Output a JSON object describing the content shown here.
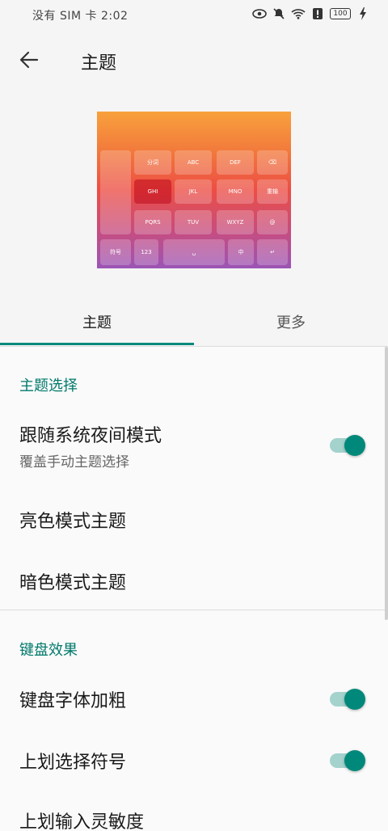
{
  "status_bar": {
    "text": "没有 SIM 卡 2:02",
    "battery": "100",
    "icons": [
      "eye-icon",
      "mute-icon",
      "wifi-icon",
      "alert-icon",
      "battery-icon",
      "charging-icon"
    ]
  },
  "header": {
    "title": "主题",
    "back_icon": "back-arrow-icon"
  },
  "keyboard_preview": {
    "rows": [
      [
        "分词",
        "ABC",
        "DEF",
        "⌫"
      ],
      [
        "GHI",
        "JKL",
        "MNO",
        "重输"
      ],
      [
        "PQRS",
        "TUV",
        "WXYZ",
        "@"
      ]
    ],
    "bottom": [
      "符号",
      "123",
      "␣",
      "中",
      "↵"
    ]
  },
  "tabs": [
    {
      "label": "主题",
      "active": true
    },
    {
      "label": "更多",
      "active": false
    }
  ],
  "sections": {
    "theme": {
      "header": "主题选择",
      "follow_system": {
        "title": "跟随系统夜间模式",
        "subtitle": "覆盖手动主题选择",
        "enabled": true
      },
      "light_theme": {
        "title": "亮色模式主题"
      },
      "dark_theme": {
        "title": "暗色模式主题"
      }
    },
    "effects": {
      "header": "键盘效果",
      "bold_font": {
        "title": "键盘字体加粗",
        "enabled": true
      },
      "swipe_up_symbol": {
        "title": "上划选择符号",
        "enabled": true
      },
      "swipe_sensitivity": {
        "title": "上划输入灵敏度"
      }
    }
  },
  "colors": {
    "accent": "#00897b",
    "section_header": "#00796b",
    "switch_track": "#a4d2cc"
  }
}
